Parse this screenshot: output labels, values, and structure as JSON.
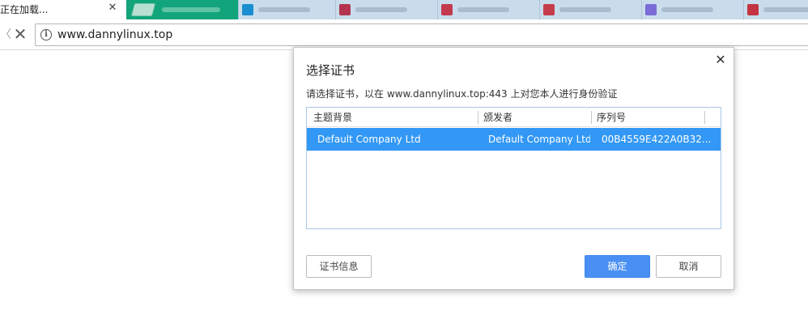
{
  "tabs": {
    "active": {
      "title": "正在加载...",
      "close_glyph": "✕"
    },
    "others": [
      {
        "fav_color": "#1a8ed0"
      },
      {
        "fav_color": "#b3354f"
      },
      {
        "fav_color": "#c23a4c"
      },
      {
        "fav_color": "#c53c4a"
      },
      {
        "fav_color": "#b8303f"
      },
      {
        "fav_color": "#7a6bd6"
      },
      {
        "fav_color": "#c23440"
      }
    ],
    "accent_color": "#12a57b"
  },
  "toolbar": {
    "back_glyph": "〈",
    "stop_glyph": "✕",
    "info_glyph": "i",
    "url": "www.dannylinux.top"
  },
  "dialog": {
    "title": "选择证书",
    "close_glyph": "✕",
    "description": "请选择证书，以在 www.dannylinux.top:443 上对您本人进行身份验证",
    "columns": [
      "主题背景",
      "颁发者",
      "序列号"
    ],
    "rows": [
      {
        "subject": "Default Company Ltd",
        "issuer": "Default Company Ltd",
        "serial": "00B4559E422A0B32...",
        "selected": true
      }
    ],
    "buttons": {
      "cert_info": "证书信息",
      "ok": "确定",
      "cancel": "取消"
    },
    "colors": {
      "selection": "#3398f5",
      "primary_button": "#4a8ff3"
    }
  }
}
